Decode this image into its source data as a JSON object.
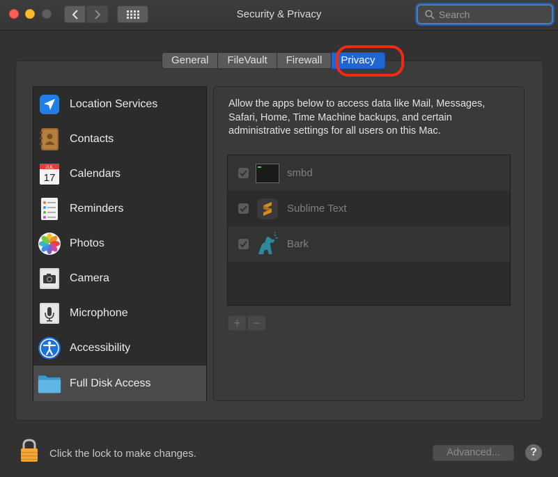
{
  "window": {
    "title": "Security & Privacy"
  },
  "search": {
    "placeholder": "Search"
  },
  "tabs": [
    {
      "label": "General",
      "active": false
    },
    {
      "label": "FileVault",
      "active": false
    },
    {
      "label": "Firewall",
      "active": false
    },
    {
      "label": "Privacy",
      "active": true
    }
  ],
  "sidebar": {
    "items": [
      {
        "label": "Location Services",
        "icon": "location-arrow-icon"
      },
      {
        "label": "Contacts",
        "icon": "contacts-book-icon"
      },
      {
        "label": "Calendars",
        "icon": "calendar-icon",
        "icon_month": "JUL",
        "icon_day": "17"
      },
      {
        "label": "Reminders",
        "icon": "reminders-list-icon"
      },
      {
        "label": "Photos",
        "icon": "photos-flower-icon"
      },
      {
        "label": "Camera",
        "icon": "camera-icon"
      },
      {
        "label": "Microphone",
        "icon": "microphone-icon"
      },
      {
        "label": "Accessibility",
        "icon": "accessibility-icon"
      },
      {
        "label": "Full Disk Access",
        "icon": "folder-icon",
        "selected": true
      }
    ]
  },
  "main": {
    "description": "Allow the apps below to access data like Mail, Messages, Safari, Home, Time Machine backups, and certain administrative settings for all users on this Mac.",
    "apps": [
      {
        "name": "smbd",
        "checked": true,
        "icon": "terminal-icon"
      },
      {
        "name": "Sublime Text",
        "checked": true,
        "icon": "sublime-text-icon"
      },
      {
        "name": "Bark",
        "checked": true,
        "icon": "bark-dog-icon"
      }
    ],
    "add_label": "+",
    "remove_label": "−"
  },
  "footer": {
    "lock_text": "Click the lock to make changes.",
    "advanced_label": "Advanced...",
    "help_label": "?"
  },
  "colors": {
    "accent": "#1e66d4",
    "highlight": "#f12a16",
    "background": "#323232"
  }
}
